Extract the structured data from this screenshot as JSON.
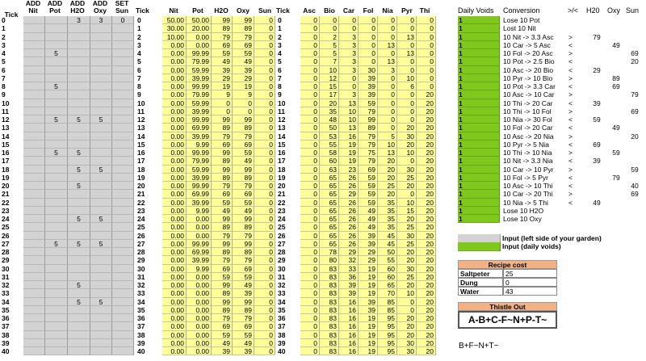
{
  "headers": {
    "tick_a": "Tick",
    "add_nit": "ADD Nit",
    "add_pot": "ADD Pot",
    "add_h2o": "ADD H2O",
    "add_oxy": "ADD Oxy",
    "set_sun": "SET Sun",
    "tick_b": "Tick",
    "nit": "Nit",
    "pot": "Pot",
    "h2o": "H2O",
    "oxy": "Oxy",
    "sun": "Sun",
    "tick_c": "Tick",
    "asc": "Asc",
    "bio": "Bio",
    "car": "Car",
    "fol": "Fol",
    "nia": "Nia",
    "pyr": "Pyr",
    "thi": "Thi",
    "daily_voids": "Daily Voids",
    "conversion": "Conversion",
    "cmp": ">/<",
    "h2o_r": "H20",
    "oxy_r": "Oxy",
    "sun_r": "Sun"
  },
  "ticks": [
    "0",
    "1",
    "2",
    "3",
    "4",
    "5",
    "6",
    "7",
    "8",
    "9",
    "10",
    "11",
    "12",
    "13",
    "14",
    "15",
    "16",
    "17",
    "18",
    "19",
    "20",
    "21",
    "22",
    "23",
    "24",
    "25",
    "26",
    "27",
    "28",
    "29",
    "30",
    "31",
    "32",
    "33",
    "34",
    "35",
    "36",
    "37",
    "38",
    "39",
    "40"
  ],
  "input_rows": [
    [
      "",
      "",
      "3",
      "3",
      "0"
    ],
    [
      "",
      "",
      "",
      "",
      ""
    ],
    [
      "",
      "",
      "",
      "",
      ""
    ],
    [
      "",
      "",
      "",
      "",
      ""
    ],
    [
      "",
      "5",
      "",
      "",
      ""
    ],
    [
      "",
      "",
      "",
      "",
      ""
    ],
    [
      "",
      "",
      "",
      "",
      ""
    ],
    [
      "",
      "",
      "",
      "",
      ""
    ],
    [
      "",
      "5",
      "",
      "",
      ""
    ],
    [
      "",
      "",
      "",
      "",
      ""
    ],
    [
      "",
      "",
      "",
      "",
      ""
    ],
    [
      "",
      "",
      "",
      "",
      ""
    ],
    [
      "",
      "5",
      "5",
      "5",
      ""
    ],
    [
      "",
      "",
      "",
      "",
      ""
    ],
    [
      "",
      "",
      "",
      "",
      ""
    ],
    [
      "",
      "",
      "",
      "",
      ""
    ],
    [
      "",
      "5",
      "5",
      "",
      ""
    ],
    [
      "",
      "",
      "",
      "",
      ""
    ],
    [
      "",
      "",
      "5",
      "5",
      ""
    ],
    [
      "",
      "",
      "",
      "",
      ""
    ],
    [
      "",
      "",
      "5",
      "",
      ""
    ],
    [
      "",
      "",
      "",
      "",
      ""
    ],
    [
      "",
      "",
      "",
      "",
      ""
    ],
    [
      "",
      "",
      "",
      "",
      ""
    ],
    [
      "",
      "",
      "5",
      "5",
      ""
    ],
    [
      "",
      "",
      "",
      "",
      ""
    ],
    [
      "",
      "",
      "",
      "",
      ""
    ],
    [
      "",
      "5",
      "5",
      "5",
      ""
    ],
    [
      "",
      "",
      "",
      "",
      ""
    ],
    [
      "",
      "",
      "",
      "",
      ""
    ],
    [
      "",
      "",
      "",
      "",
      ""
    ],
    [
      "",
      "",
      "",
      "",
      ""
    ],
    [
      "",
      "",
      "5",
      "",
      ""
    ],
    [
      "",
      "",
      "",
      "",
      ""
    ],
    [
      "",
      "",
      "5",
      "5",
      ""
    ],
    [
      "",
      "",
      "",
      "",
      ""
    ],
    [
      "",
      "",
      "",
      "",
      ""
    ],
    [
      "",
      "",
      "",
      "",
      ""
    ],
    [
      "",
      "",
      "",
      "",
      ""
    ],
    [
      "",
      "",
      "",
      "",
      ""
    ],
    [
      "",
      "",
      "",
      "",
      ""
    ]
  ],
  "state_rows": [
    [
      "50.00",
      "50.00",
      "99",
      "99",
      "0"
    ],
    [
      "30.00",
      "20.00",
      "89",
      "89",
      "0"
    ],
    [
      "10.00",
      "0.00",
      "79",
      "79",
      "0"
    ],
    [
      "0.00",
      "0.00",
      "69",
      "69",
      "0"
    ],
    [
      "0.00",
      "99.99",
      "59",
      "59",
      "0"
    ],
    [
      "0.00",
      "79.99",
      "49",
      "49",
      "0"
    ],
    [
      "0.00",
      "59.99",
      "39",
      "39",
      "0"
    ],
    [
      "0.00",
      "39.99",
      "29",
      "29",
      "0"
    ],
    [
      "0.00",
      "99.99",
      "19",
      "19",
      "0"
    ],
    [
      "0.00",
      "79.99",
      "9",
      "9",
      "0"
    ],
    [
      "0.00",
      "59.99",
      "0",
      "0",
      "0"
    ],
    [
      "0.00",
      "39.99",
      "0",
      "0",
      "0"
    ],
    [
      "0.00",
      "99.99",
      "99",
      "99",
      "0"
    ],
    [
      "0.00",
      "69.99",
      "89",
      "89",
      "0"
    ],
    [
      "0.00",
      "39.99",
      "79",
      "79",
      "0"
    ],
    [
      "0.00",
      "9.99",
      "69",
      "69",
      "0"
    ],
    [
      "0.00",
      "99.99",
      "99",
      "59",
      "0"
    ],
    [
      "0.00",
      "79.99",
      "89",
      "49",
      "0"
    ],
    [
      "0.00",
      "59.99",
      "99",
      "99",
      "0"
    ],
    [
      "0.00",
      "39.99",
      "89",
      "89",
      "0"
    ],
    [
      "0.00",
      "99.99",
      "79",
      "79",
      "0"
    ],
    [
      "0.00",
      "69.99",
      "69",
      "69",
      "0"
    ],
    [
      "0.00",
      "39.99",
      "59",
      "59",
      "0"
    ],
    [
      "0.00",
      "9.99",
      "49",
      "49",
      "0"
    ],
    [
      "0.00",
      "0.00",
      "99",
      "99",
      "0"
    ],
    [
      "0.00",
      "0.00",
      "89",
      "89",
      "0"
    ],
    [
      "0.00",
      "0.00",
      "79",
      "79",
      "0"
    ],
    [
      "0.00",
      "99.99",
      "99",
      "99",
      "0"
    ],
    [
      "0.00",
      "69.99",
      "89",
      "89",
      "0"
    ],
    [
      "0.00",
      "39.99",
      "79",
      "79",
      "0"
    ],
    [
      "0.00",
      "9.99",
      "69",
      "69",
      "0"
    ],
    [
      "0.00",
      "0.00",
      "59",
      "59",
      "0"
    ],
    [
      "0.00",
      "0.00",
      "99",
      "49",
      "0"
    ],
    [
      "0.00",
      "0.00",
      "89",
      "39",
      "0"
    ],
    [
      "0.00",
      "0.00",
      "99",
      "99",
      "0"
    ],
    [
      "0.00",
      "0.00",
      "89",
      "89",
      "0"
    ],
    [
      "0.00",
      "0.00",
      "79",
      "79",
      "0"
    ],
    [
      "0.00",
      "0.00",
      "69",
      "69",
      "0"
    ],
    [
      "0.00",
      "0.00",
      "59",
      "59",
      "0"
    ],
    [
      "0.00",
      "0.00",
      "49",
      "49",
      "0"
    ],
    [
      "0.00",
      "0.00",
      "39",
      "39",
      "0"
    ]
  ],
  "vitamin_rows": [
    [
      "0",
      "0",
      "0",
      "0",
      "0",
      "0",
      "0"
    ],
    [
      "0",
      "0",
      "0",
      "0",
      "0",
      "0",
      "0"
    ],
    [
      "0",
      "2",
      "3",
      "0",
      "0",
      "13",
      "0"
    ],
    [
      "0",
      "5",
      "3",
      "0",
      "13",
      "0",
      "0"
    ],
    [
      "0",
      "5",
      "3",
      "0",
      "0",
      "13",
      "0"
    ],
    [
      "0",
      "7",
      "3",
      "0",
      "13",
      "0",
      "0"
    ],
    [
      "0",
      "10",
      "3",
      "30",
      "3",
      "0",
      "0"
    ],
    [
      "0",
      "12",
      "0",
      "39",
      "0",
      "10",
      "0"
    ],
    [
      "0",
      "15",
      "0",
      "39",
      "0",
      "6",
      "0"
    ],
    [
      "0",
      "17",
      "3",
      "39",
      "0",
      "0",
      "20"
    ],
    [
      "0",
      "20",
      "13",
      "59",
      "0",
      "0",
      "20"
    ],
    [
      "0",
      "35",
      "10",
      "79",
      "0",
      "0",
      "20"
    ],
    [
      "0",
      "48",
      "10",
      "99",
      "0",
      "0",
      "20"
    ],
    [
      "0",
      "50",
      "13",
      "89",
      "0",
      "20",
      "20"
    ],
    [
      "0",
      "53",
      "16",
      "79",
      "5",
      "30",
      "20"
    ],
    [
      "0",
      "55",
      "19",
      "79",
      "10",
      "20",
      "20"
    ],
    [
      "0",
      "58",
      "19",
      "75",
      "13",
      "10",
      "20"
    ],
    [
      "0",
      "60",
      "19",
      "79",
      "20",
      "0",
      "20"
    ],
    [
      "0",
      "63",
      "23",
      "69",
      "20",
      "30",
      "20"
    ],
    [
      "0",
      "65",
      "26",
      "59",
      "20",
      "25",
      "20"
    ],
    [
      "0",
      "65",
      "26",
      "59",
      "25",
      "20",
      "20"
    ],
    [
      "0",
      "65",
      "29",
      "59",
      "20",
      "0",
      "20"
    ],
    [
      "0",
      "65",
      "26",
      "59",
      "35",
      "10",
      "20"
    ],
    [
      "0",
      "65",
      "26",
      "49",
      "35",
      "15",
      "20"
    ],
    [
      "0",
      "65",
      "26",
      "49",
      "35",
      "20",
      "20"
    ],
    [
      "0",
      "65",
      "26",
      "49",
      "35",
      "25",
      "20"
    ],
    [
      "0",
      "65",
      "26",
      "39",
      "45",
      "30",
      "20"
    ],
    [
      "0",
      "65",
      "26",
      "39",
      "45",
      "25",
      "20"
    ],
    [
      "0",
      "78",
      "29",
      "29",
      "50",
      "20",
      "20"
    ],
    [
      "0",
      "80",
      "32",
      "29",
      "55",
      "20",
      "20"
    ],
    [
      "0",
      "83",
      "33",
      "19",
      "60",
      "30",
      "20"
    ],
    [
      "0",
      "83",
      "36",
      "19",
      "60",
      "25",
      "20"
    ],
    [
      "0",
      "83",
      "39",
      "19",
      "65",
      "20",
      "20"
    ],
    [
      "0",
      "83",
      "39",
      "19",
      "70",
      "10",
      "20"
    ],
    [
      "0",
      "83",
      "16",
      "39",
      "85",
      "0",
      "20"
    ],
    [
      "0",
      "83",
      "16",
      "39",
      "85",
      "0",
      "20"
    ],
    [
      "0",
      "83",
      "16",
      "19",
      "95",
      "20",
      "20"
    ],
    [
      "0",
      "83",
      "16",
      "19",
      "95",
      "20",
      "20"
    ],
    [
      "0",
      "83",
      "16",
      "19",
      "95",
      "20",
      "20"
    ],
    [
      "0",
      "83",
      "16",
      "19",
      "95",
      "30",
      "20"
    ],
    [
      "0",
      "83",
      "16",
      "19",
      "95",
      "30",
      "20"
    ]
  ],
  "daily_voids": [
    "1",
    "1",
    "1",
    "1",
    "1",
    "1",
    "1",
    "1",
    "1",
    "1",
    "1",
    "1",
    "1",
    "1",
    "1",
    "1",
    "1",
    "1",
    "1",
    "1",
    "1",
    "1",
    "1",
    "1",
    "1"
  ],
  "conversions": [
    [
      "Lose 10 Pot",
      "",
      "",
      "",
      ""
    ],
    [
      "Lost 10 Nit",
      "",
      "",
      "",
      ""
    ],
    [
      "10 Nit -> 3.3 Asc",
      ">",
      "79",
      "",
      ""
    ],
    [
      "10 Car -> 5 Asc",
      "<",
      "",
      "49",
      ""
    ],
    [
      "10 Fol -> 20 Asc",
      ">",
      "",
      "",
      "69"
    ],
    [
      "10 Pot -> 2.5 Bio",
      "<",
      "",
      "",
      "20"
    ],
    [
      "10 Asc -> 20 Bio",
      "<",
      "29",
      "",
      ""
    ],
    [
      "10 Pyr -> 10 Bio",
      ">",
      "",
      "89",
      ""
    ],
    [
      "10 Pot -> 3.3 Car",
      "<",
      "",
      "69",
      ""
    ],
    [
      "10 Asc -> 10 Car",
      ">",
      "",
      "",
      "79"
    ],
    [
      "10 Thi -> 20 Car",
      "<",
      "39",
      "",
      ""
    ],
    [
      "10 Thi -> 10 Fol",
      ">",
      "",
      "",
      "69"
    ],
    [
      "10 Nia -> 30 Fol",
      "<",
      "59",
      "",
      ""
    ],
    [
      "10 Fol -> 20 Car",
      "<",
      "",
      "49",
      ""
    ],
    [
      "10 Asc -> 20 Nia",
      ">",
      "",
      "",
      "20"
    ],
    [
      "10 Pyr -> 5 Nia",
      "<",
      "69",
      "",
      ""
    ],
    [
      "10 Thi -> 10 Nia",
      ">",
      "",
      "59",
      ""
    ],
    [
      "10 Nit -> 3.3 Nia",
      "<",
      "39",
      "",
      ""
    ],
    [
      "10 Car -> 10 Pyr",
      ">",
      "",
      "",
      "59"
    ],
    [
      "10 Fol -> 5 Pyr",
      "<",
      "",
      "79",
      ""
    ],
    [
      "10 Asc -> 10 Thi",
      "<",
      "",
      "",
      "40"
    ],
    [
      "10 Car -> 20 Thi",
      ">",
      "",
      "",
      "69"
    ],
    [
      "10 Nia -> 5 Thi",
      "<",
      "49",
      "",
      ""
    ],
    [
      "Lose 10 H2O",
      "",
      "",
      "",
      ""
    ],
    [
      "Lose 10 Oxy",
      "",
      "",
      "",
      ""
    ]
  ],
  "legend": {
    "gray_label": "Input (left side of your garden)",
    "green_label": "Input (daily voids)"
  },
  "recipe": {
    "title": "Recipe cost",
    "rows": [
      [
        "Saltpeter",
        "25"
      ],
      [
        "Dung",
        "0"
      ],
      [
        "Water",
        "43"
      ]
    ]
  },
  "thistle": {
    "title": "Thistle Out",
    "formula": "A-B+C-F~N+P-T~",
    "formula2": "B+F~N+T~"
  }
}
